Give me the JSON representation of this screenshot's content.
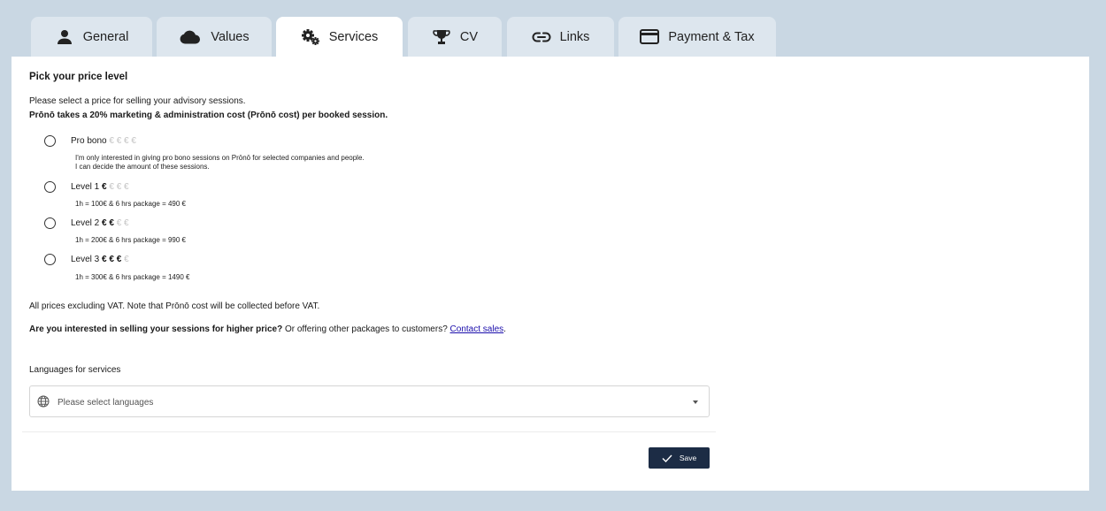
{
  "tabs": [
    {
      "label": "General",
      "icon": "person-icon"
    },
    {
      "label": "Values",
      "icon": "cloud-icon"
    },
    {
      "label": "Services",
      "icon": "gears-icon",
      "active": true
    },
    {
      "label": "CV",
      "icon": "trophy-icon"
    },
    {
      "label": "Links",
      "icon": "link-icon"
    },
    {
      "label": "Payment & Tax",
      "icon": "credit-card-icon"
    }
  ],
  "price": {
    "heading": "Pick your price level",
    "intro_line1": "Please select a price for selling your advisory sessions.",
    "intro_line2": "Prōnō takes a 20% marketing & administration cost (Prōnō cost) per booked session.",
    "options": [
      {
        "label": "Pro bono",
        "euros_active": "",
        "euros_inactive": "€ € € €",
        "description": "I'm only interested in giving pro bono sessions on Prōnō for selected companies and people.\nI can decide the amount of these sessions."
      },
      {
        "label": "Level 1",
        "euros_active": "€",
        "euros_inactive": "€ € €",
        "description": "1h = 100€ & 6 hrs package = 490 €"
      },
      {
        "label": "Level 2",
        "euros_active": "€ €",
        "euros_inactive": "€ €",
        "description": "1h = 200€ & 6 hrs package = 990 €"
      },
      {
        "label": "Level 3",
        "euros_active": "€ € €",
        "euros_inactive": "€",
        "description": "1h = 300€ & 6 hrs package = 1490 €"
      }
    ],
    "vat_note": "All prices excluding VAT. Note that Prōnō cost will be collected before VAT.",
    "higher_bold": "Are you interested in selling your sessions for higher price?",
    "higher_rest": " Or offering other packages to customers? ",
    "contact_link": "Contact sales",
    "period": "."
  },
  "languages": {
    "label": "Languages for services",
    "placeholder": "Please select languages"
  },
  "save_label": "Save"
}
